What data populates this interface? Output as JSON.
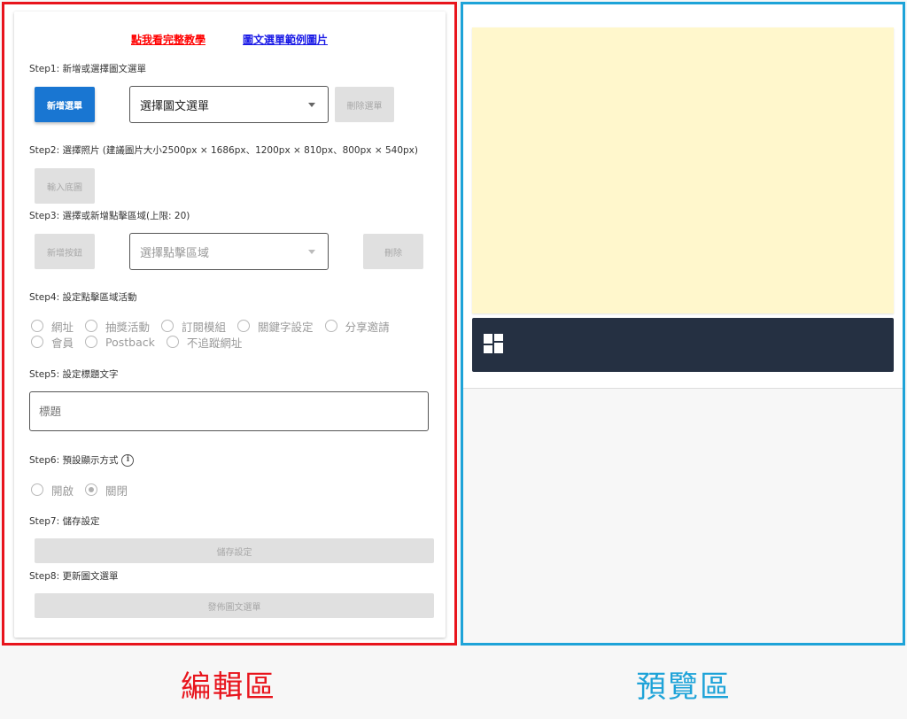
{
  "links": {
    "tutorial": "點我看完整教學",
    "example": "圖文選單範例圖片"
  },
  "steps": {
    "step1": "Step1: 新增或選擇圖文選單",
    "step2": "Step2: 選擇照片 (建議圖片大小2500px × 1686px、1200px × 810px、800px × 540px)",
    "step3": "Step3: 選擇或新增點擊區域(上限: 20)",
    "step4": "Step4: 設定點擊區域活動",
    "step5": "Step5: 設定標題文字",
    "step6": "Step6: 預設顯示方式",
    "step7": "Step7: 儲存設定",
    "step8": "Step8: 更新圖文選單"
  },
  "step1": {
    "add_button": "新增選單",
    "select_value": "選擇圖文選單",
    "delete_button": "刪除選單"
  },
  "step2": {
    "import_button": "輸入底圖"
  },
  "step3": {
    "add_button": "新增按鈕",
    "select_value": "選擇點擊區域",
    "delete_button": "刪除"
  },
  "step4": {
    "options": [
      "網址",
      "抽獎活動",
      "訂閱模組",
      "關鍵字設定",
      "分享邀請",
      "會員",
      "Postback",
      "不追蹤網址"
    ]
  },
  "step5": {
    "placeholder": "標題"
  },
  "step6": {
    "info_icon": "info-icon",
    "options": [
      "開啟",
      "關閉"
    ],
    "selected": "關閉"
  },
  "step7": {
    "save_button": "儲存設定"
  },
  "step8": {
    "publish_button": "發佈圖文選單"
  },
  "preview": {
    "image_color": "#fff7cc",
    "bar_color": "#253042",
    "bar_icon": "grid-icon"
  },
  "captions": {
    "editor": "編輯區",
    "preview": "預覽區"
  },
  "colors": {
    "editor_border": "#e8141c",
    "preview_border": "#1ea3d8",
    "primary": "#1976d2"
  }
}
